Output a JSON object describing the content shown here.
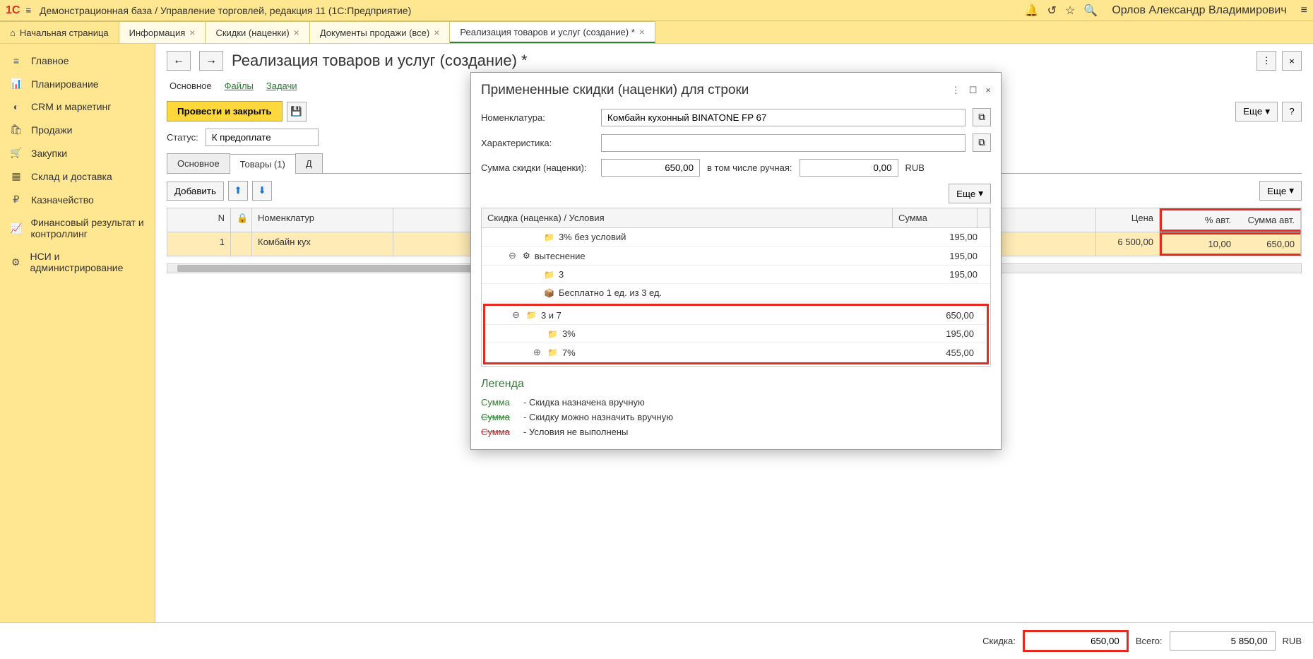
{
  "header": {
    "title": "Демонстрационная база / Управление торговлей, редакция 11  (1С:Предприятие)",
    "user": "Орлов Александр Владимирович"
  },
  "tabs": [
    {
      "label": "Начальная страница",
      "home": true
    },
    {
      "label": "Информация",
      "closable": true
    },
    {
      "label": "Скидки (наценки)",
      "closable": true
    },
    {
      "label": "Документы продажи (все)",
      "closable": true
    },
    {
      "label": "Реализация товаров и услуг (создание) *",
      "closable": true,
      "active": true
    }
  ],
  "sidebar": [
    {
      "icon": "≡",
      "label": "Главное"
    },
    {
      "icon": "📊",
      "label": "Планирование"
    },
    {
      "icon": "◐",
      "label": "CRM и маркетинг"
    },
    {
      "icon": "🛍",
      "label": "Продажи"
    },
    {
      "icon": "🛒",
      "label": "Закупки"
    },
    {
      "icon": "▦",
      "label": "Склад и доставка"
    },
    {
      "icon": "₽",
      "label": "Казначейство"
    },
    {
      "icon": "📈",
      "label": "Финансовый результат и контроллинг"
    },
    {
      "icon": "⚙",
      "label": "НСИ и администрирование"
    }
  ],
  "page": {
    "title": "Реализация товаров и услуг (создание) *",
    "form_tabs": [
      "Основное",
      "Файлы",
      "Задачи"
    ],
    "btn_post_close": "Провести и закрыть",
    "more": "Еще",
    "help": "?",
    "status_label": "Статус:",
    "status_value": "К предоплате",
    "doc_tabs": [
      "Основное",
      "Товары (1)",
      "Д"
    ],
    "add_btn": "Добавить",
    "grid": {
      "headers": {
        "n": "N",
        "nom": "Номенклатур",
        "price": "Цена",
        "pct": "% авт.",
        "sum": "Сумма авт."
      },
      "row": {
        "n": "1",
        "nom": "Комбайн кух",
        "price": "6 500,00",
        "pct": "10,00",
        "sum": "650,00"
      }
    }
  },
  "popup": {
    "title": "Примененные скидки (наценки) для строки",
    "nom_label": "Номенклатура:",
    "nom_value": "Комбайн кухонный BINATONE FP 67",
    "char_label": "Характеристика:",
    "char_value": "",
    "sum_label": "Сумма скидки (наценки):",
    "sum_value": "650,00",
    "manual_label": "в том числе ручная:",
    "manual_value": "0,00",
    "currency": "RUB",
    "more": "Еще",
    "tree_header": {
      "name": "Скидка (наценка) / Условия",
      "sum": "Сумма"
    },
    "tree": [
      {
        "indent": 1,
        "icon": "📁",
        "name": "3% без условий",
        "sum": "195,00"
      },
      {
        "indent": 2,
        "expand": "⊖",
        "icon": "⚙",
        "name": "вытеснение",
        "sum": "195,00"
      },
      {
        "indent": 3,
        "icon": "📁",
        "name": "3",
        "sum": "195,00"
      },
      {
        "indent": 3,
        "icon": "📦",
        "name": "Бесплатно 1 ед. из 3 ед.",
        "sum": ""
      },
      {
        "indent": 2,
        "expand": "⊖",
        "icon": "📁",
        "name": "3 и 7",
        "sum": "650,00",
        "hl": true
      },
      {
        "indent": 3,
        "icon": "📁",
        "name": "3%",
        "sum": "195,00",
        "hl": true
      },
      {
        "indent": 3,
        "expand": "⊕",
        "icon": "📁",
        "name": "7%",
        "sum": "455,00",
        "hl": true
      }
    ],
    "legend": {
      "title": "Легенда",
      "items": [
        {
          "cls": "lg-green",
          "label": "Сумма",
          "desc": "- Скидка назначена вручную"
        },
        {
          "cls": "lg-green-strike",
          "label": "Сумма",
          "desc": "- Скидку можно назначить вручную"
        },
        {
          "cls": "lg-red-strike",
          "label": "Сумма",
          "desc": "- Условия не выполнены"
        }
      ]
    }
  },
  "footer": {
    "discount_label": "Скидка:",
    "discount_value": "650,00",
    "total_label": "Всего:",
    "total_value": "5 850,00",
    "currency": "RUB"
  }
}
